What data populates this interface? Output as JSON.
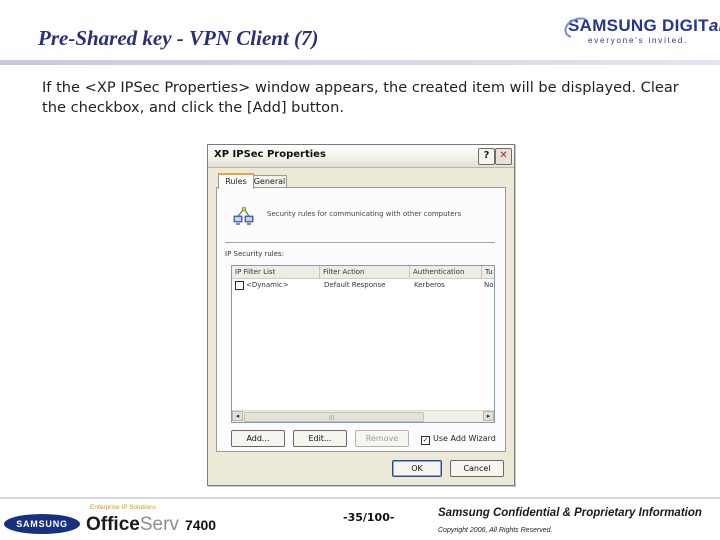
{
  "slide": {
    "title": "Pre-Shared key - VPN Client (7)",
    "instruction": "If the <XP IPSec Properties> window appears, the created item will be displayed. Clear the checkbox, and click the [Add] button."
  },
  "brand": {
    "logo_main": "SAMSUNG DIGIT",
    "logo_main_italic": "all",
    "logo_tagline": "everyone's invited."
  },
  "window": {
    "title": "XP IPSec Properties",
    "help_glyph": "?",
    "close_glyph": "✕",
    "tabs": [
      {
        "label": "Rules",
        "selected": true
      },
      {
        "label": "General",
        "selected": false
      }
    ],
    "description": "Security rules for communicating with other computers",
    "list_label": "IP Security rules:",
    "columns": [
      "IP Filter List",
      "Filter Action",
      "Authentication",
      "Tu"
    ],
    "rows": [
      {
        "checked": false,
        "cells": [
          "<Dynamic>",
          "Default Response",
          "Kerberos",
          "No"
        ]
      }
    ],
    "scroll_left": "◂",
    "scroll_right": "▸",
    "scroll_grip": "|||",
    "buttons": {
      "add": "Add...",
      "edit": "Edit...",
      "remove": "Remove",
      "ok": "OK",
      "cancel": "Cancel"
    },
    "wizard_label": "Use Add Wizard",
    "wizard_checked": true,
    "wizard_check_glyph": "✓"
  },
  "footer": {
    "samsung_logo": "SAMSUNG",
    "product_tagline": "Enterprise IP Solutions",
    "product_name_bold": "Office",
    "product_name_light": "Serv",
    "product_model": "7400",
    "page_number": "-35/100-",
    "confidential": "Samsung Confidential & Proprietary Information",
    "copyright": "Copyright 2006, All Rights Reserved."
  },
  "colors": {
    "title": "#2a2f7a",
    "brand_blue": "#27358f",
    "window_bg": "#ece9d8",
    "tab_highlight": "#f0a33c",
    "close_red": "#b51f1f"
  }
}
